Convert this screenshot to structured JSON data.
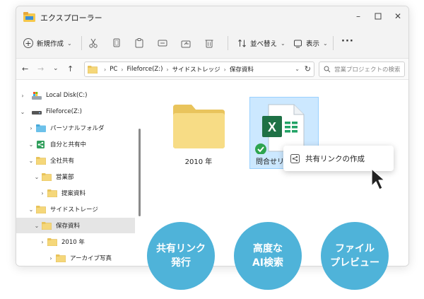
{
  "window": {
    "title": "エクスプローラー"
  },
  "toolbar": {
    "new_label": "新規作成",
    "sort_label": "並べ替え",
    "view_label": "表示",
    "more_label": "···"
  },
  "address": {
    "segments": [
      "PC",
      "Fileforce(Z:)",
      "サイドストレッジ",
      "保存資料"
    ],
    "search_placeholder": "営業プロジェクトの検索"
  },
  "sidebar": {
    "items": [
      {
        "label": "Local Disk(C:)"
      },
      {
        "label": "Fileforce(Z:)"
      },
      {
        "label": "パーソナルフォルダ"
      },
      {
        "label": "自分と共有中"
      },
      {
        "label": "全社共有"
      },
      {
        "label": "営業部"
      },
      {
        "label": "提案資料"
      },
      {
        "label": "サイドストレージ"
      },
      {
        "label": "保存資料"
      },
      {
        "label": "2010 年"
      },
      {
        "label": "アーカイブ写真"
      }
    ]
  },
  "content": {
    "folder_label": "2010 年",
    "file_label": "問合せリスト"
  },
  "context_menu": {
    "item_label": "共有リンクの作成"
  },
  "features": [
    {
      "line1": "共有リンク",
      "line2": "発行"
    },
    {
      "line1": "高度な",
      "line2": "AI検索"
    },
    {
      "line1": "ファイル",
      "line2": "プレビュー"
    }
  ],
  "colors": {
    "accent": "#4fb3d9",
    "folder": "#f5d77a",
    "excel": "#1e7145",
    "selection": "#cce8ff",
    "check": "#2ea44f"
  }
}
